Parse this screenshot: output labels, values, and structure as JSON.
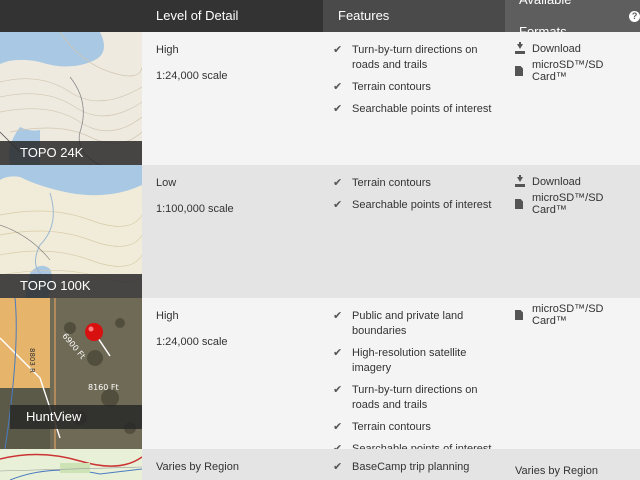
{
  "header": {
    "col_level": "Level of Detail",
    "col_features": "Features",
    "col_formats": "Available Formats",
    "help_icon": "?"
  },
  "rows": [
    {
      "name": "TOPO 24K",
      "level": "High",
      "scale": "1:24,000 scale",
      "features": [
        "Turn-by-turn directions on roads and trails",
        "Terrain contours",
        "Searchable points of interest"
      ],
      "formats": [
        {
          "icon": "download-icon",
          "label": "Download"
        },
        {
          "icon": "sd-card-icon",
          "label": "microSD™/SD Card™"
        }
      ]
    },
    {
      "name": "TOPO 100K",
      "level": "Low",
      "scale": "1:100,000 scale",
      "features": [
        "Terrain contours",
        "Searchable points of interest"
      ],
      "formats": [
        {
          "icon": "download-icon",
          "label": "Download"
        },
        {
          "icon": "sd-card-icon",
          "label": "microSD™/SD Card™"
        }
      ]
    },
    {
      "name": "HuntView",
      "level": "High",
      "scale": "1:24,000 scale",
      "features": [
        "Public and private land boundaries",
        "High-resolution satellite imagery",
        "Turn-by-turn directions on roads and trails",
        "Terrain contours",
        "Searchable points of interest"
      ],
      "formats": [
        {
          "icon": "sd-card-icon",
          "label": "microSD™/SD Card™"
        }
      ],
      "map_labels": [
        "6900 Ft",
        "8160 Ft",
        "8803 R"
      ]
    },
    {
      "level": "Varies by Region",
      "features": [
        "BaseCamp trip planning"
      ],
      "formats_text": "Varies by Region"
    }
  ],
  "colors": {
    "header_dark": "#333333",
    "header_mid": "#4a4a4a",
    "header_light": "#5e5e5e",
    "row_light": "#f4f4f4",
    "row_dark": "#e4e4e4"
  }
}
